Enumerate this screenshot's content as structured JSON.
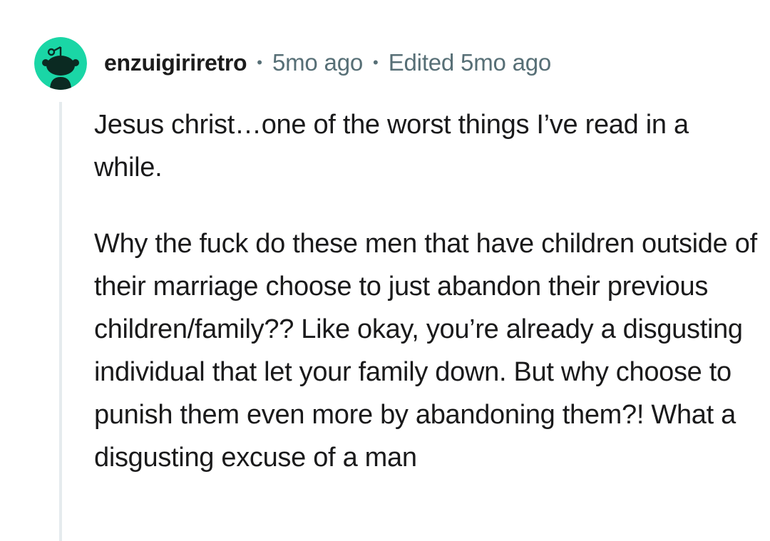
{
  "comment": {
    "author": "enzuigiriretro",
    "separator": "•",
    "posted": "5mo ago",
    "edited": "Edited 5mo ago",
    "avatar_icon": "reddit-snoo-avatar-icon",
    "avatar_color": "#1ad6a6",
    "paragraphs": [
      "Jesus christ…one of the worst things I’ve read in a while.",
      "Why the fuck do these men that have children outside of their marriage choose to just abandon their previous children/family?? Like okay, you’re already a disgusting individual that let your family down. But why choose to punish them even more by abandoning them?! What a disgusting excuse of a man"
    ]
  },
  "colors": {
    "meta": "#576f76",
    "text": "#1a1a1b",
    "thread_line": "#e5ebee"
  }
}
